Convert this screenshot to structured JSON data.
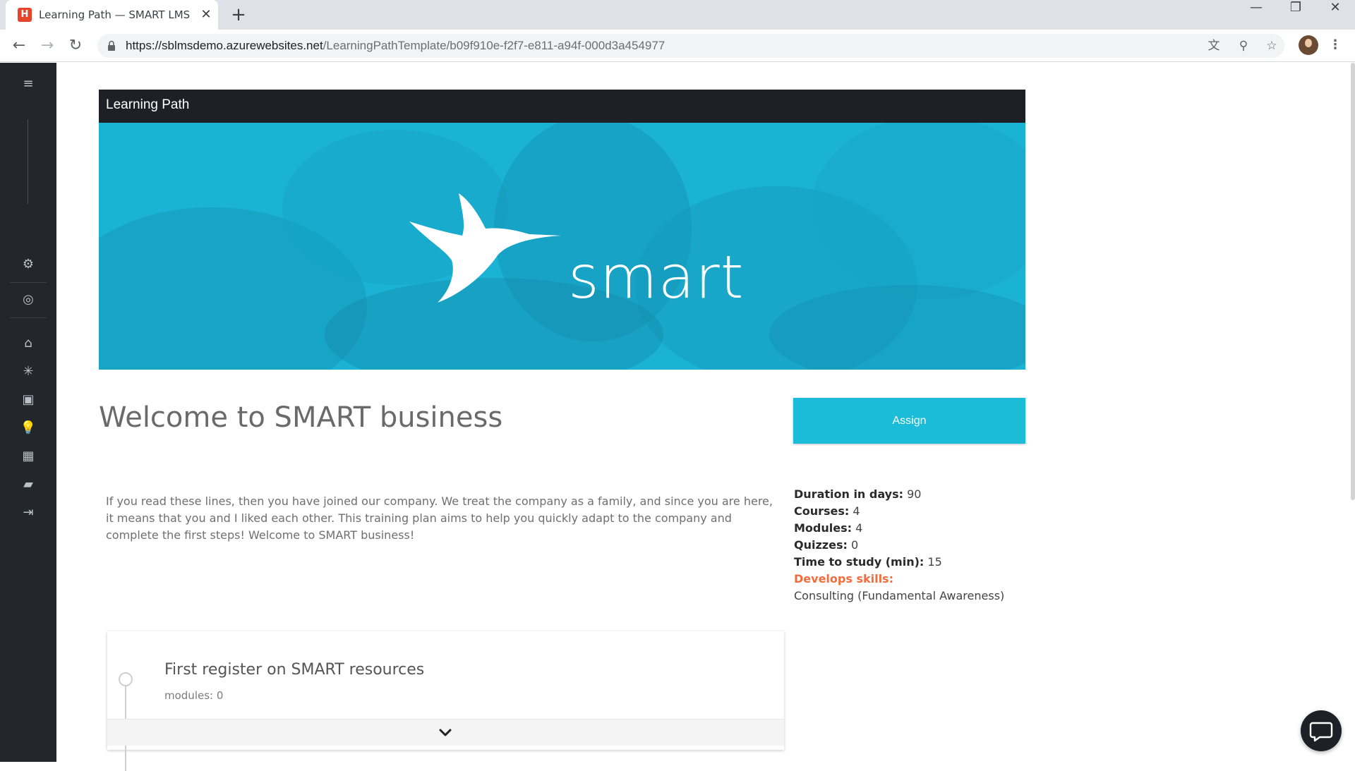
{
  "browser": {
    "tab_title": "Learning Path — SMART LMS",
    "tab_favicon": "H",
    "close_glyph": "✕",
    "new_tab_glyph": "+",
    "url_host": "https://sblmsdemo.azurewebsites.net",
    "url_path": "/LearningPathTemplate/b09f910e-f2f7-e811-a94f-000d3a454977"
  },
  "window_controls": {
    "minimize": "—",
    "restore": "❐",
    "close": "✕"
  },
  "sidebar": {
    "items": [
      {
        "name": "menu-icon",
        "glyph": "≡"
      },
      {
        "name": "settings-gears-icon",
        "glyph": "⚙"
      },
      {
        "name": "target-icon",
        "glyph": "◎"
      },
      {
        "name": "home-icon",
        "glyph": "⌂"
      },
      {
        "name": "network-icon",
        "glyph": "✳"
      },
      {
        "name": "presentation-icon",
        "glyph": "▣"
      },
      {
        "name": "lightbulb-icon",
        "glyph": "💡"
      },
      {
        "name": "calendar-icon",
        "glyph": "▦"
      },
      {
        "name": "folder-icon",
        "glyph": "▰"
      },
      {
        "name": "logout-icon",
        "glyph": "⇥"
      }
    ]
  },
  "header": {
    "title": "Learning Path"
  },
  "banner": {
    "logo_text": "smart",
    "accent_color": "#1ab3d6"
  },
  "main": {
    "title": "Welcome to SMART business",
    "assign_label": "Assign",
    "description": "If you read these lines, then you have joined our company. We treat the company as a family, and since you are here, it means that you and I liked each other. This training plan aims to help you quickly adapt to the company and complete the first steps! Welcome to SMART business!"
  },
  "stats": {
    "duration_label": "Duration in days:",
    "duration_value": "90",
    "courses_label": "Courses:",
    "courses_value": "4",
    "modules_label": "Modules:",
    "modules_value": "4",
    "quizzes_label": "Quizzes:",
    "quizzes_value": "0",
    "time_label": "Time to study (min):",
    "time_value": "15",
    "skills_label": "Develops skills:",
    "skills_value": "Consulting (Fundamental Awareness)"
  },
  "course": {
    "title": "First register on SMART resources",
    "modules_text": "modules: 0"
  },
  "colors": {
    "accent": "#1bbcd8",
    "skills": "#f36c3c",
    "dark": "#1d2126"
  }
}
